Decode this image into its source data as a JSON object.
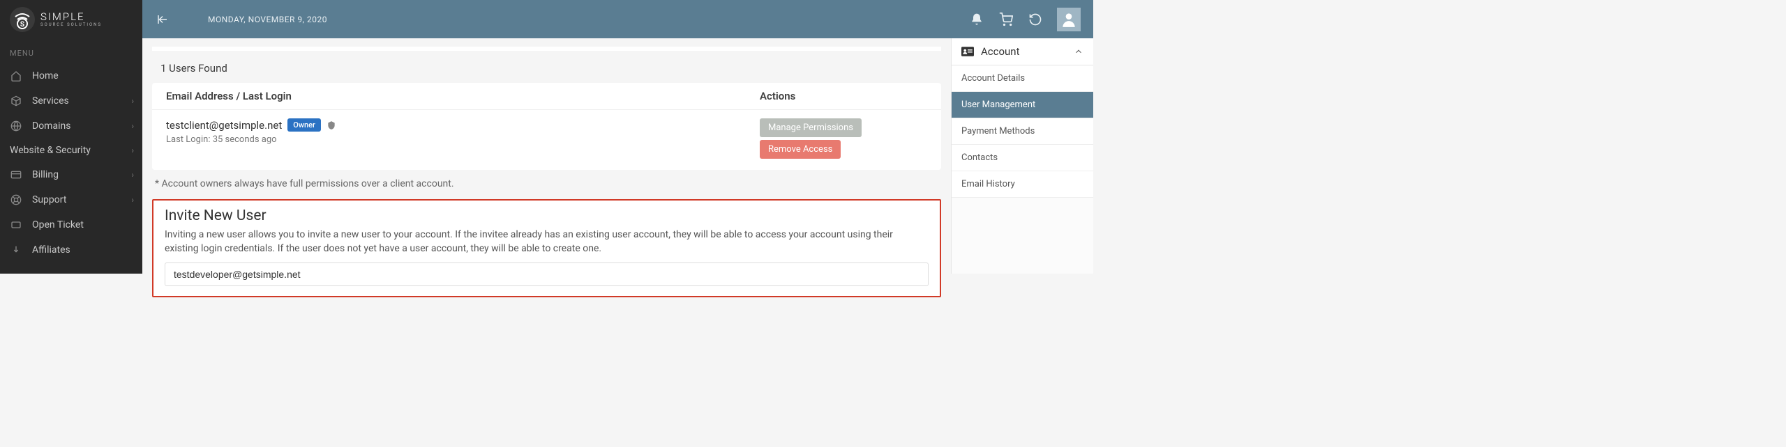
{
  "brand": {
    "name": "SIMPLE",
    "subtitle": "SOURCE SOLUTIONS"
  },
  "menu_label": "MENU",
  "nav": {
    "home": "Home",
    "services": "Services",
    "domains": "Domains",
    "website_security": "Website & Security",
    "billing": "Billing",
    "support": "Support",
    "open_ticket": "Open Ticket",
    "affiliates": "Affiliates"
  },
  "topbar": {
    "date": "MONDAY, NOVEMBER 9, 2020"
  },
  "users": {
    "count_text": "1 Users Found",
    "col_email": "Email Address / Last Login",
    "col_actions": "Actions",
    "rows": [
      {
        "email": "testclient@getsimple.net",
        "badge": "Owner",
        "last_login": "Last Login: 35 seconds ago",
        "manage_label": "Manage Permissions",
        "remove_label": "Remove Access"
      }
    ],
    "footnote": "* Account owners always have full permissions over a client account."
  },
  "invite": {
    "title": "Invite New User",
    "description": "Inviting a new user allows you to invite a new user to your account. If the invitee already has an existing user account, they will be able to access your account using their existing login credentials. If the user does not yet have a user account, they will be able to create one.",
    "input_value": "testdeveloper@getsimple.net"
  },
  "right_panel": {
    "title": "Account",
    "items": {
      "details": "Account Details",
      "user_mgmt": "User Management",
      "payment": "Payment Methods",
      "contacts": "Contacts",
      "email_history": "Email History"
    }
  }
}
